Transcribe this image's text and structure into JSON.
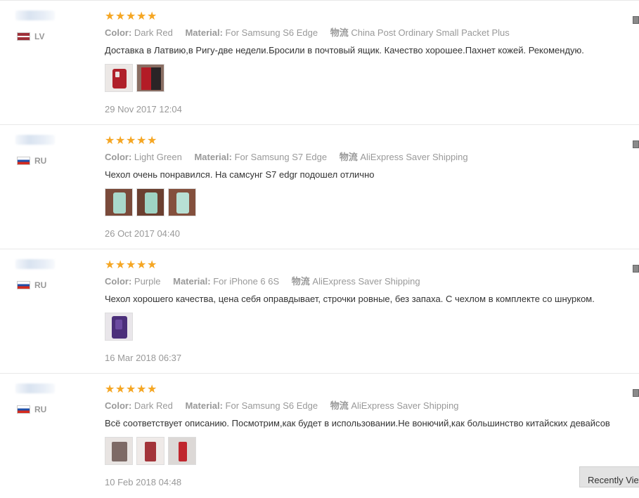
{
  "labels": {
    "color": "Color:",
    "material": "Material:",
    "shipping": "物流"
  },
  "stars": [
    "★",
    "★",
    "★",
    "★",
    "★"
  ],
  "reviews": [
    {
      "country": "LV",
      "flag": "lv",
      "color": "Dark Red",
      "material": "For Samsung S6 Edge",
      "shipping": "China Post Ordinary Small Packet Plus",
      "text": "Доставка в Латвию,в Ригу-две недели.Бросили в почтовый ящик. Качество хорошее.Пахнет кожей. Рекомендую.",
      "date": "29 Nov 2017 12:04",
      "photos": 2
    },
    {
      "country": "RU",
      "flag": "ru",
      "color": "Light Green",
      "material": "For Samsung S7 Edge",
      "shipping": "AliExpress Saver Shipping",
      "text": "Чехол очень понравился. На самсунг S7 edgr подошел отлично",
      "date": "26 Oct 2017 04:40",
      "photos": 3
    },
    {
      "country": "RU",
      "flag": "ru",
      "color": "Purple",
      "material": "For iPhone 6 6S",
      "shipping": "AliExpress Saver Shipping",
      "text": "Чехол хорошего качества, цена себя оправдывает, строчки ровные, без запаха. С чехлом в комплекте со шнурком.",
      "date": "16 Mar 2018 06:37",
      "photos": 1
    },
    {
      "country": "RU",
      "flag": "ru",
      "color": "Dark Red",
      "material": "For Samsung S6 Edge",
      "shipping": "AliExpress Saver Shipping",
      "text": "Всё соответствует описанию. Посмотрим,как будет в использовании.Не вонючий,как большинство китайских девайсов",
      "date": "10 Feb 2018 04:48",
      "photos": 3
    }
  ],
  "recently_viewed": "Recently Viewed"
}
